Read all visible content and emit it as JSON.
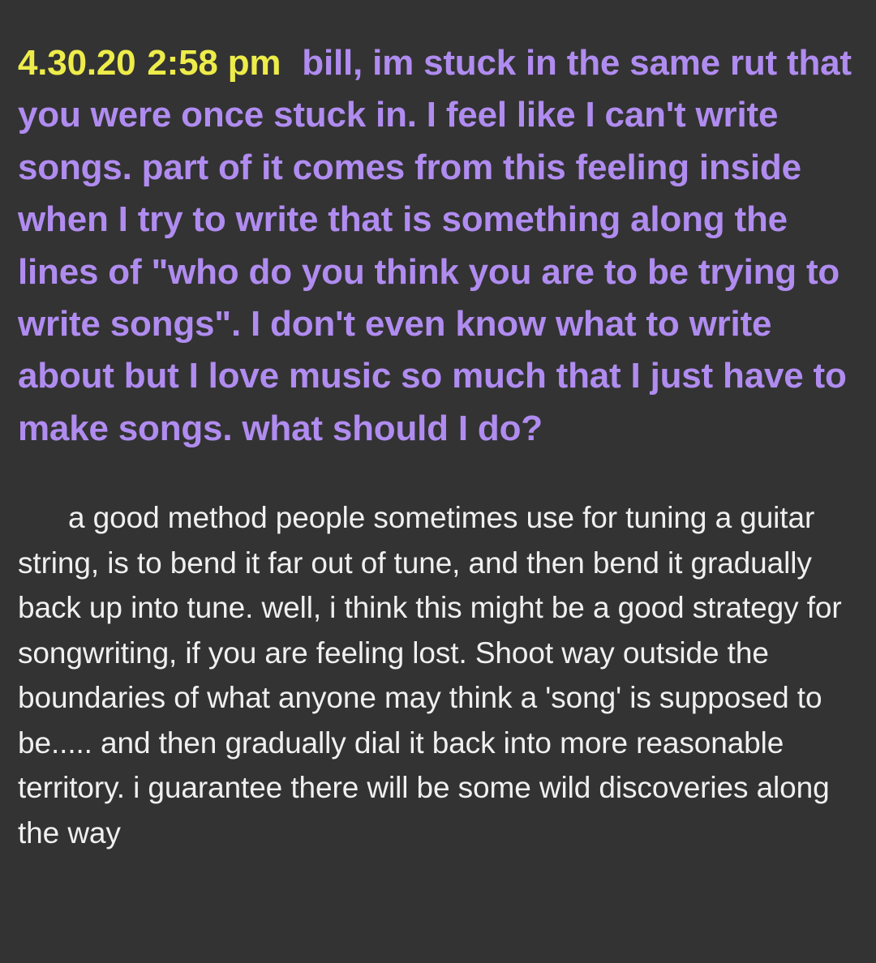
{
  "entry": {
    "date": "4.30.20",
    "time": "2:58 pm",
    "question": "bill, im stuck in the same rut that you were once stuck in. I feel like I can't write songs. part of it comes from this feeling inside when I try to write that is something along the lines of \"who do you think you are to be trying to write songs\". I don't even know what to write about but I love music so much that I just have to make songs. what should I do?",
    "answer": "a good method people sometimes use for tuning a guitar string, is to bend it far out of tune, and then bend it gradually back up into tune. well, i think this might be a good strategy for songwriting, if you are feeling lost. Shoot way outside the boundaries of what anyone may think a 'song' is supposed to be..... and then gradually dial it back into more reasonable territory. i guarantee there will be some wild discoveries along the way"
  },
  "colors": {
    "background": "#333333",
    "timestamp": "#EDEC4A",
    "question": "#B08CF0",
    "answer": "#F0F0F0"
  }
}
